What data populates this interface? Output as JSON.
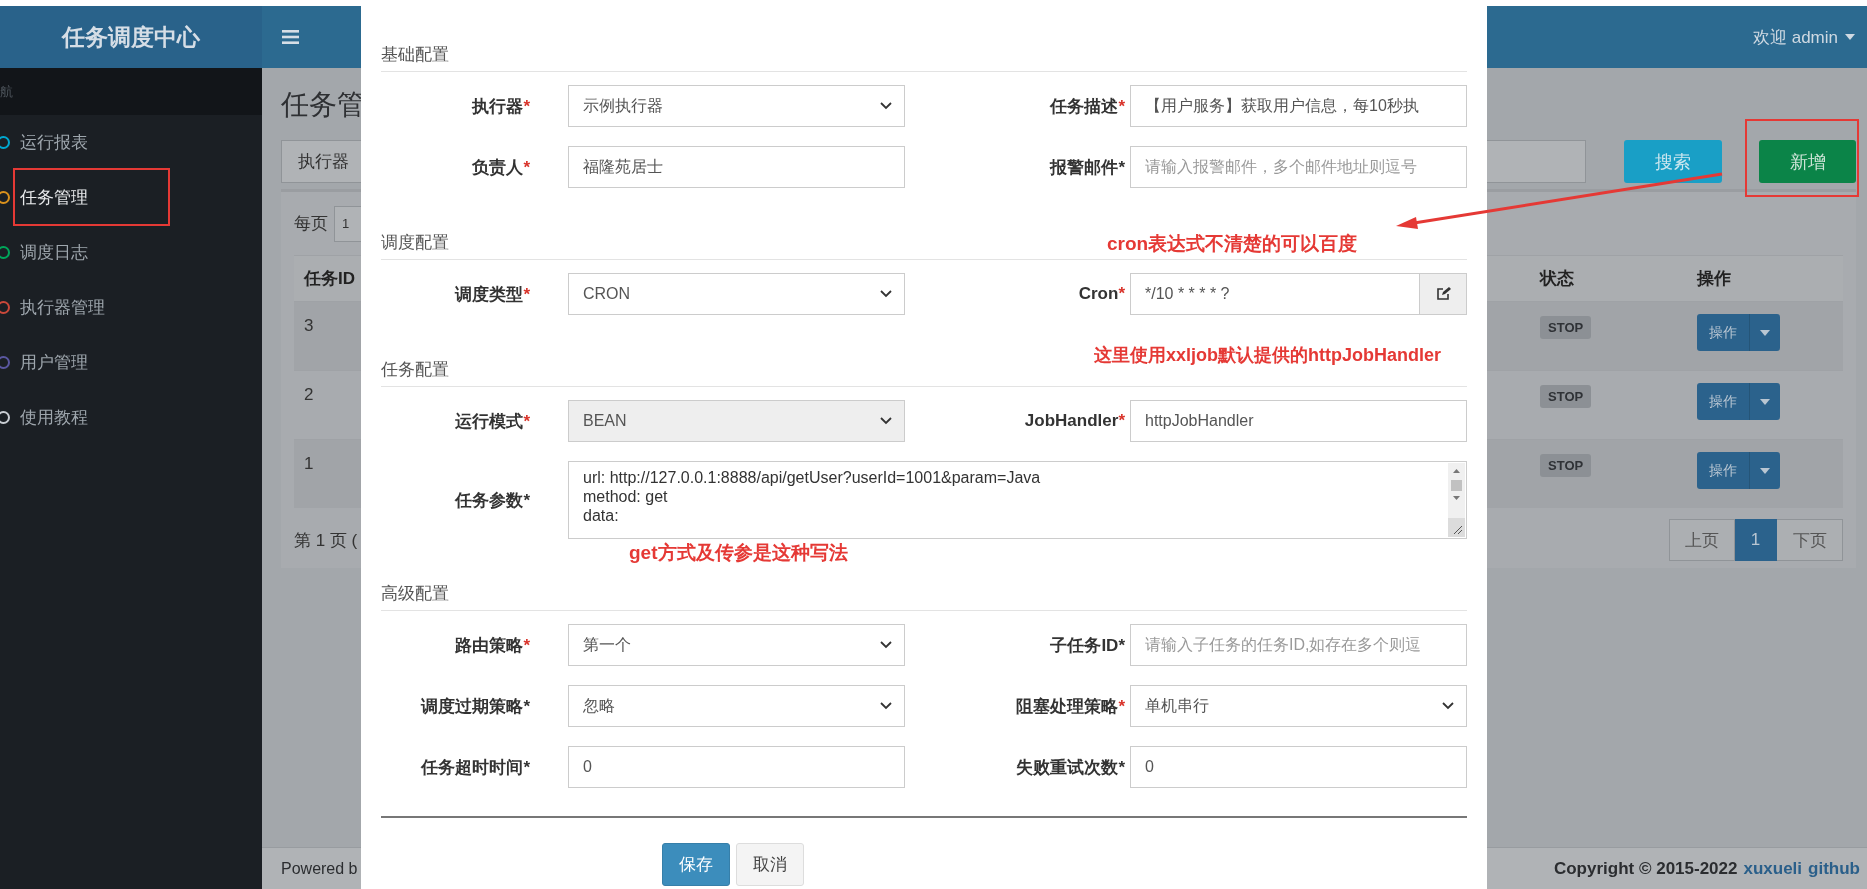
{
  "header": {
    "logo": "任务调度中心",
    "user": "欢迎 admin"
  },
  "sidebar": {
    "heading": "航",
    "items": [
      {
        "label": "运行报表",
        "color": "#00a7d0",
        "selected": false
      },
      {
        "label": "任务管理",
        "color": "#d9901c",
        "selected": true
      },
      {
        "label": "调度日志",
        "color": "#00a65a",
        "selected": false
      },
      {
        "label": "执行器管理",
        "color": "#c9483a",
        "selected": false
      },
      {
        "label": "用户管理",
        "color": "#5a57a0",
        "selected": false
      },
      {
        "label": "使用教程",
        "color": "#c8ccd2",
        "selected": false
      }
    ]
  },
  "page": {
    "title": "任务管",
    "filter_label": "执行器",
    "search_button": "搜索",
    "add_button": "新增",
    "page_size_label": "每页",
    "page_size_value": "1",
    "table": {
      "columns": [
        "任务ID",
        "状态",
        "操作"
      ],
      "rows": [
        {
          "id": "3",
          "status": "STOP",
          "action": "操作"
        },
        {
          "id": "2",
          "status": "STOP",
          "action": "操作"
        },
        {
          "id": "1",
          "status": "STOP",
          "action": "操作"
        }
      ]
    },
    "page_info": "第 1 页 (",
    "pagination": [
      {
        "label": "上页",
        "selected": false
      },
      {
        "label": "1",
        "selected": true
      },
      {
        "label": "下页",
        "selected": false
      }
    ]
  },
  "footer": {
    "powered": "Powered b",
    "copyright": "Copyright © 2015-2022",
    "links": [
      "xuxueli",
      "github"
    ]
  },
  "modal": {
    "sections": [
      {
        "title": "基础配置",
        "fields": [
          {
            "label": "执行器",
            "marker": "*",
            "marker_red": true,
            "kind": "select",
            "value": "示例执行器",
            "disabled": false
          },
          {
            "label": "任务描述",
            "marker": "*",
            "marker_red": true,
            "kind": "input",
            "value": "【用户服务】获取用户信息，每10秒执",
            "disabled": false
          },
          {
            "label": "负责人",
            "marker": "*",
            "marker_red": true,
            "kind": "input",
            "value": "福隆苑居士",
            "disabled": false
          },
          {
            "label": "报警邮件",
            "marker": "*",
            "marker_red": false,
            "kind": "input",
            "placeholder": "请输入报警邮件，多个邮件地址则逗号",
            "disabled": false
          }
        ]
      },
      {
        "title": "调度配置",
        "fields": [
          {
            "label": "调度类型",
            "marker": "*",
            "marker_red": true,
            "kind": "select",
            "value": "CRON",
            "disabled": false
          },
          {
            "label": "Cron",
            "marker": "*",
            "marker_red": true,
            "kind": "addon",
            "value": "*/10 * * * * ?",
            "disabled": false
          }
        ]
      },
      {
        "title": "任务配置",
        "fields": [
          {
            "label": "运行模式",
            "marker": "*",
            "marker_red": true,
            "kind": "select",
            "value": "BEAN",
            "disabled": true
          },
          {
            "label": "JobHandler",
            "marker": "*",
            "marker_red": true,
            "kind": "input",
            "value": "httpJobHandler",
            "disabled": false
          },
          {
            "label": "任务参数",
            "marker": "*",
            "marker_red": false,
            "kind": "textarea",
            "lines": [
              "url: http://127.0.0.1:8888/api/getUser?userId=1001&param=Java",
              "method: get",
              "data:"
            ],
            "disabled": false
          }
        ]
      },
      {
        "title": "高级配置",
        "fields": [
          {
            "label": "路由策略",
            "marker": "*",
            "marker_red": true,
            "kind": "select",
            "value": "第一个",
            "disabled": false
          },
          {
            "label": "子任务ID",
            "marker": "*",
            "marker_red": false,
            "kind": "input",
            "placeholder": "请输入子任务的任务ID,如存在多个则逗",
            "disabled": false
          },
          {
            "label": "调度过期策略",
            "marker": "*",
            "marker_red": false,
            "kind": "select",
            "value": "忽略",
            "disabled": false
          },
          {
            "label": "阻塞处理策略",
            "marker": "*",
            "marker_red": true,
            "kind": "select",
            "value": "单机串行",
            "disabled": false
          },
          {
            "label": "任务超时时间",
            "marker": "*",
            "marker_red": false,
            "kind": "input",
            "value": "0",
            "disabled": false
          },
          {
            "label": "失败重试次数",
            "marker": "*",
            "marker_red": false,
            "kind": "input",
            "value": "0",
            "disabled": false
          }
        ]
      }
    ],
    "buttons": [
      {
        "label": "保存",
        "kind": "primary"
      },
      {
        "label": "取消",
        "kind": "default"
      }
    ]
  },
  "annotations": [
    {
      "text": "cron表达式不清楚的可以百度"
    },
    {
      "text": "这里使用xxljob默认提供的httpJobHandler"
    },
    {
      "text": "get方式及传参是这种写法"
    }
  ]
}
